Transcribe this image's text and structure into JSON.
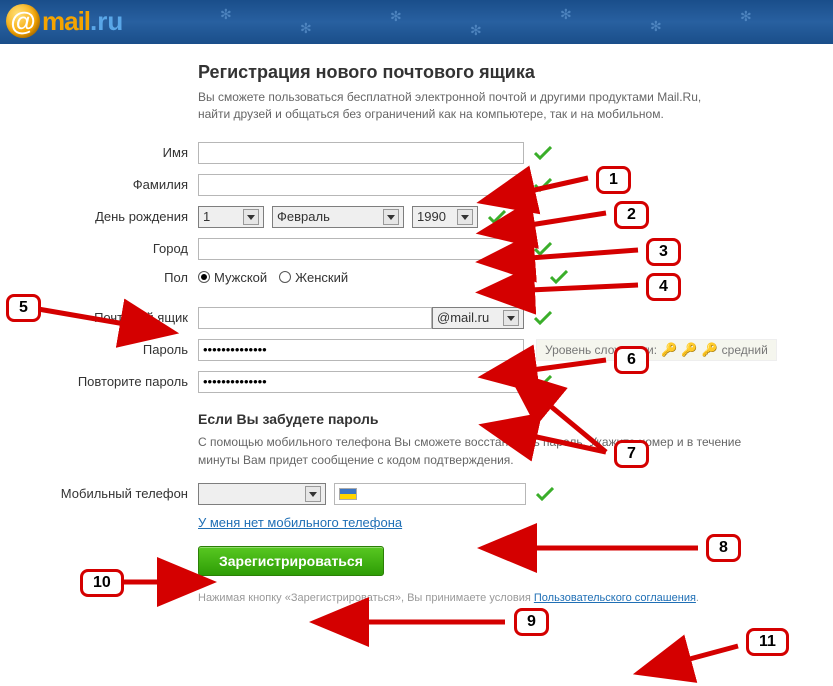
{
  "logo": {
    "mail": "mail",
    "ru": ".ru"
  },
  "title": "Регистрация нового почтового ящика",
  "subtitle": "Вы сможете пользоваться бесплатной электронной почтой и другими продуктами Mail.Ru, найти друзей и общаться без ограничений как на компьютере, так и на мобильном.",
  "labels": {
    "first_name": "Имя",
    "last_name": "Фамилия",
    "birthday": "День рождения",
    "city": "Город",
    "gender": "Пол",
    "mailbox": "Почтовый ящик",
    "password": "Пароль",
    "password_repeat": "Повторите пароль",
    "mobile": "Мобильный телефон"
  },
  "values": {
    "first_name": "",
    "last_name": "",
    "bd_day": "1",
    "bd_month": "Февраль",
    "bd_year": "1990",
    "city": "",
    "gender_male": "Мужской",
    "gender_female": "Женский",
    "mail_user": "",
    "mail_domain": "@mail.ru",
    "password": "••••••••••••••",
    "password_repeat": "••••••••••••••",
    "phone_country": "",
    "phone_number": ""
  },
  "password_strength": {
    "label": "Уровень сложности:",
    "level_text": "средний"
  },
  "forgot": {
    "title": "Если Вы забудете пароль",
    "text": "С помощью мобильного телефона Вы сможете восстановить пароль. Укажите номер и в течение минуты Вам придет сообщение с кодом подтверждения."
  },
  "no_phone_link": "У меня нет мобильного телефона",
  "register_button": "Зарегистрироваться",
  "footer_prefix": "Нажимая кнопку «Зарегистрироваться», Вы принимаете условия ",
  "footer_link": "Пользовательского соглашения",
  "callouts": [
    "1",
    "2",
    "3",
    "4",
    "5",
    "6",
    "7",
    "8",
    "9",
    "10",
    "11"
  ]
}
